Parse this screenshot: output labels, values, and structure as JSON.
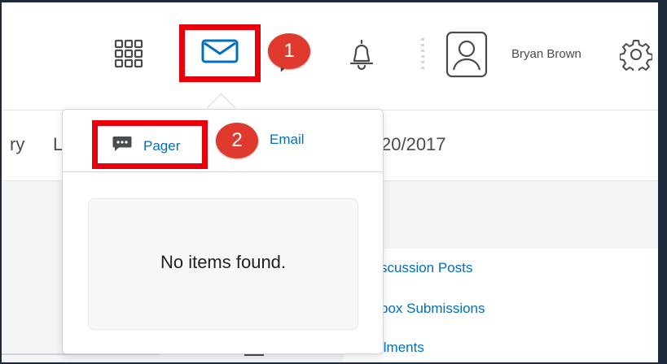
{
  "header": {
    "user_name": "Bryan Brown",
    "icons": [
      "grid-icon",
      "mail-icon",
      "chat-icon",
      "bell-icon",
      "avatar-icon",
      "gear-icon"
    ]
  },
  "callouts": {
    "one": "1",
    "two": "2"
  },
  "nav": {
    "frag_a": "ry",
    "frag_b": "L",
    "date_frag": "20/2017"
  },
  "dropdown": {
    "tabs": [
      {
        "label": "Pager",
        "icon": "pager-icon"
      },
      {
        "label": "Email"
      }
    ],
    "empty_message": "No items found."
  },
  "links": [
    "scussion Posts",
    "box Submissions",
    "llments"
  ],
  "colors": {
    "accent": "#006fbf",
    "highlight": "#e8000a",
    "badge": "#e03a2e",
    "border": "#1c2a3a"
  }
}
